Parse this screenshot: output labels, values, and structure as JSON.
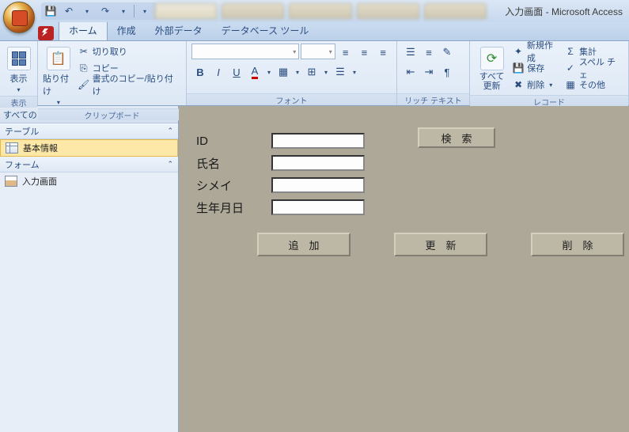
{
  "window": {
    "title": "入力画面 - Microsoft Access"
  },
  "tabs": {
    "home": "ホーム",
    "create": "作成",
    "external": "外部データ",
    "dbtools": "データベース ツール"
  },
  "ribbon": {
    "view": {
      "label": "表示",
      "group": "表示"
    },
    "clipboard": {
      "paste": "貼り付け",
      "cut": "切り取り",
      "copy": "コピー",
      "fmt": "書式のコピー/貼り付け",
      "group": "クリップボード"
    },
    "font": {
      "group": "フォント"
    },
    "rich": {
      "group": "リッチ テキスト"
    },
    "refresh": {
      "label": "すべて\n更新",
      "group": "レコード",
      "new": "新規作成",
      "save": "保存",
      "delete": "削除",
      "total": "集計",
      "spell": "スペル チェ",
      "more": "その他"
    }
  },
  "nav": {
    "title": "すべての Access オブジェクト",
    "cat_tables": "テーブル",
    "item_table": "基本情報",
    "cat_forms": "フォーム",
    "item_form": "入力画面"
  },
  "form": {
    "id": "ID",
    "name": "氏名",
    "kana": "シメイ",
    "dob": "生年月日",
    "search": "検　索",
    "add": "追　加",
    "update": "更　新",
    "delete": "削　除"
  }
}
